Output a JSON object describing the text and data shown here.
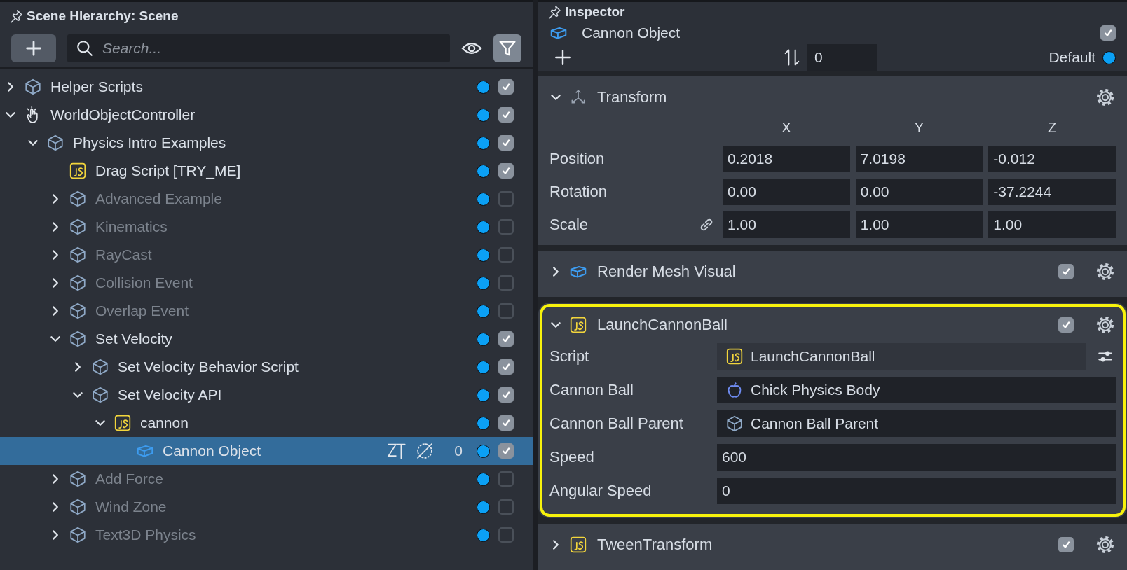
{
  "hierarchy": {
    "title": "Scene Hierarchy: Scene",
    "search": {
      "placeholder": "Search..."
    },
    "tree": [
      {
        "name": "Helper Scripts",
        "kind": "object",
        "expanded": false,
        "checked": true,
        "selected": false
      },
      {
        "name": "WorldObjectController",
        "kind": "hand",
        "expanded": true,
        "checked": true,
        "selected": false,
        "children": [
          {
            "name": "Physics Intro Examples",
            "kind": "object",
            "expanded": true,
            "checked": true,
            "selected": false,
            "children": [
              {
                "name": "Drag Script [TRY_ME]",
                "kind": "script",
                "checked": true,
                "selected": false
              },
              {
                "name": "Advanced Example",
                "kind": "object",
                "expanded": false,
                "checked": false,
                "selected": false
              },
              {
                "name": "Kinematics",
                "kind": "object",
                "expanded": false,
                "checked": false,
                "selected": false
              },
              {
                "name": "RayCast",
                "kind": "object",
                "expanded": false,
                "checked": false,
                "selected": false
              },
              {
                "name": "Collision Event",
                "kind": "object",
                "expanded": false,
                "checked": false,
                "selected": false
              },
              {
                "name": "Overlap Event",
                "kind": "object",
                "expanded": false,
                "checked": false,
                "selected": false
              },
              {
                "name": "Set Velocity",
                "kind": "object",
                "expanded": true,
                "checked": true,
                "selected": false,
                "children": [
                  {
                    "name": "Set Velocity Behavior Script",
                    "kind": "object",
                    "expanded": false,
                    "checked": true,
                    "selected": false
                  },
                  {
                    "name": "Set Velocity API",
                    "kind": "object",
                    "expanded": true,
                    "checked": true,
                    "selected": false,
                    "children": [
                      {
                        "name": "cannon",
                        "kind": "script",
                        "expanded": true,
                        "checked": true,
                        "selected": false,
                        "children": [
                          {
                            "name": "Cannon Object",
                            "kind": "mesh",
                            "checked": true,
                            "selected": true,
                            "count": "0"
                          }
                        ]
                      }
                    ]
                  }
                ]
              },
              {
                "name": "Add Force",
                "kind": "object",
                "expanded": false,
                "checked": false,
                "selected": false
              },
              {
                "name": "Wind Zone",
                "kind": "object",
                "expanded": false,
                "checked": false,
                "selected": false
              },
              {
                "name": "Text3D Physics",
                "kind": "object",
                "expanded": false,
                "checked": false,
                "selected": false
              }
            ]
          }
        ]
      }
    ]
  },
  "inspector": {
    "title": "Inspector",
    "object": {
      "name": "Cannon Object",
      "checked": true
    },
    "layer_value": "0",
    "layer_label": "Default",
    "components": [
      {
        "kind": "transform",
        "name": "Transform",
        "expanded": true,
        "highlighted": false,
        "columns": [
          "X",
          "Y",
          "Z"
        ],
        "rows": [
          {
            "label": "Position",
            "values": [
              "0.2018",
              "7.0198",
              "-0.012"
            ]
          },
          {
            "label": "Rotation",
            "values": [
              "0.00",
              "0.00",
              "-37.2244"
            ]
          },
          {
            "label": "Scale",
            "linked": true,
            "values": [
              "1.00",
              "1.00",
              "1.00"
            ]
          }
        ]
      },
      {
        "kind": "mesh",
        "name": "Render Mesh Visual",
        "expanded": false,
        "checked": true,
        "highlighted": false
      },
      {
        "kind": "script",
        "name": "LaunchCannonBall",
        "expanded": true,
        "checked": true,
        "highlighted": true,
        "fields": [
          {
            "label": "Script",
            "kind": "script",
            "value": "LaunchCannonBall"
          },
          {
            "label": "Cannon Ball",
            "kind": "physics",
            "value": "Chick Physics Body"
          },
          {
            "label": "Cannon Ball Parent",
            "kind": "object",
            "value": "Cannon Ball Parent"
          },
          {
            "label": "Speed",
            "kind": "number",
            "value": "600"
          },
          {
            "label": "Angular Speed",
            "kind": "number",
            "value": "0"
          }
        ]
      },
      {
        "kind": "script",
        "name": "TweenTransform",
        "expanded": false,
        "checked": true,
        "highlighted": false
      }
    ]
  }
}
